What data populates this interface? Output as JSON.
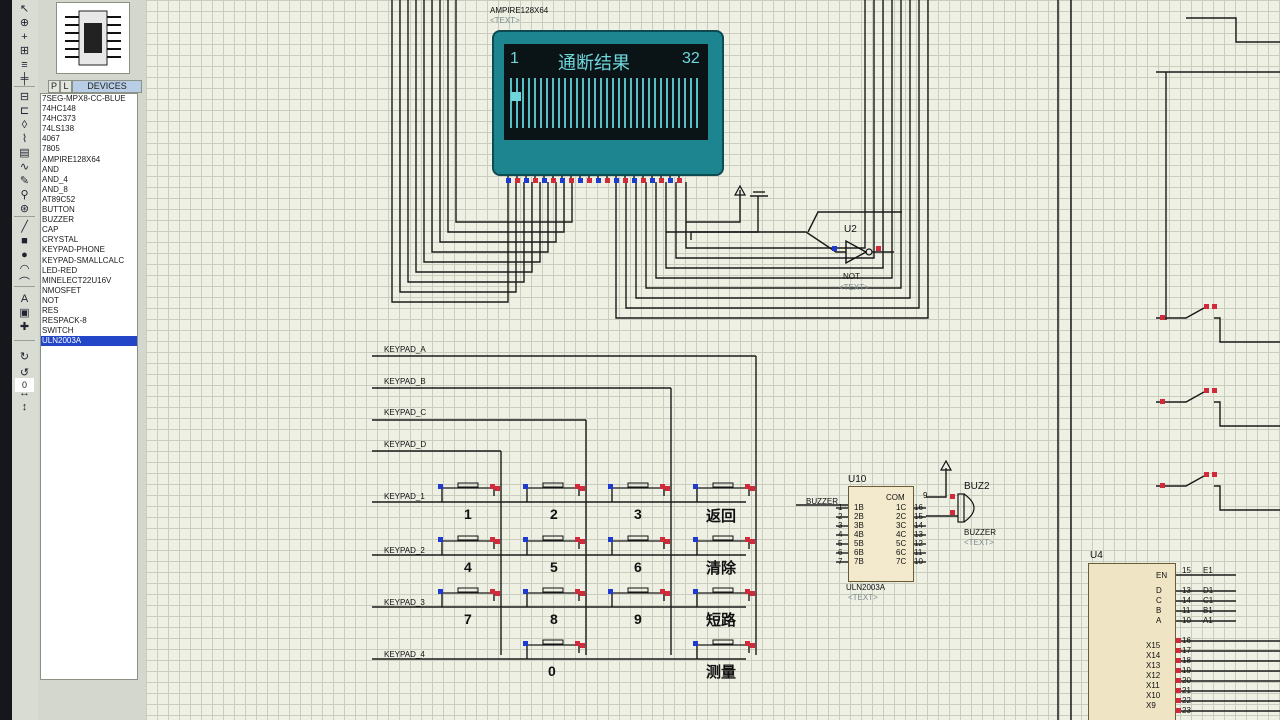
{
  "toolbar": {
    "icons": [
      "pointer-icon",
      "component-icon",
      "junction-icon",
      "label-icon",
      "text-icon",
      "bus-icon",
      "subcircuit-icon",
      "terminal-icon",
      "port-icon",
      "graph-icon",
      "tape-icon",
      "generator-icon",
      "probe-v-icon",
      "probe-i-icon",
      "instrument-icon",
      "line-icon",
      "box-icon",
      "circle-icon",
      "arc-icon",
      "path-icon",
      "text-tool-icon",
      "symbol-icon",
      "marker-icon",
      "rotate-cw-icon",
      "rotate-ccw-icon",
      "flip-h-icon",
      "flip-v-icon"
    ],
    "rotation_value": "0"
  },
  "panel": {
    "tab_p": "P",
    "tab_l": "L",
    "header": "DEVICES",
    "devices": [
      "7SEG-MPX8-CC-BLUE",
      "74HC148",
      "74HC373",
      "74LS138",
      "4067",
      "7805",
      "AMPIRE128X64",
      "AND",
      "AND_4",
      "AND_8",
      "AT89C52",
      "BUTTON",
      "BUZZER",
      "CAP",
      "CRYSTAL",
      "KEYPAD-PHONE",
      "KEYPAD-SMALLCALC",
      "LED-RED",
      "MINELECT22U16V",
      "NMOSFET",
      "NOT",
      "RES",
      "RESPACK-8",
      "SWITCH",
      "ULN2003A"
    ],
    "selected": "ULN2003A"
  },
  "lcd": {
    "part_label": "AMPIRE128X64",
    "text_tag": "<TEXT>",
    "line_left": "1",
    "line_title": "通断结果",
    "line_right": "32"
  },
  "not_gate": {
    "ref": "U2",
    "type": "NOT",
    "text_tag": "<TEXT>"
  },
  "keypad_nets": [
    "KEYPAD_A",
    "KEYPAD_B",
    "KEYPAD_C",
    "KEYPAD_D",
    "KEYPAD_1",
    "KEYPAD_2",
    "KEYPAD_3",
    "KEYPAD_4"
  ],
  "keys": {
    "row1": [
      "1",
      "2",
      "3",
      "返回"
    ],
    "row2": [
      "4",
      "5",
      "6",
      "清除"
    ],
    "row3": [
      "7",
      "8",
      "9",
      "短路"
    ],
    "row4": [
      "0",
      "测量"
    ]
  },
  "uln": {
    "ref": "U10",
    "type": "ULN2003A",
    "text_tag": "<TEXT>",
    "net": "BUZZER",
    "pins_left": [
      "1B",
      "2B",
      "3B",
      "4B",
      "5B",
      "6B",
      "7B"
    ],
    "pins_left_nums": [
      "1",
      "2",
      "3",
      "4",
      "5",
      "6",
      "7"
    ],
    "com": "COM",
    "com_num": "9",
    "pins_right": [
      "1C",
      "2C",
      "3C",
      "4C",
      "5C",
      "6C",
      "7C"
    ],
    "pins_right_nums": [
      "16",
      "15",
      "14",
      "13",
      "12",
      "11",
      "10"
    ]
  },
  "buzzer": {
    "ref": "BUZ2",
    "type": "BUZZER",
    "text_tag": "<TEXT>"
  },
  "u4": {
    "ref": "U4",
    "en": "EN",
    "en_num": "15",
    "en_net": "E1",
    "inputs": [
      "D",
      "C",
      "B",
      "A"
    ],
    "input_nums": [
      "13",
      "14",
      "11",
      "10"
    ],
    "input_nets": [
      "D1",
      "C1",
      "B1",
      "A1"
    ],
    "outputs": [
      "X15",
      "X14",
      "X13",
      "X12",
      "X11",
      "X10",
      "X9"
    ],
    "output_nums": [
      "16",
      "17",
      "18",
      "19",
      "20",
      "21",
      "22",
      "23"
    ]
  }
}
